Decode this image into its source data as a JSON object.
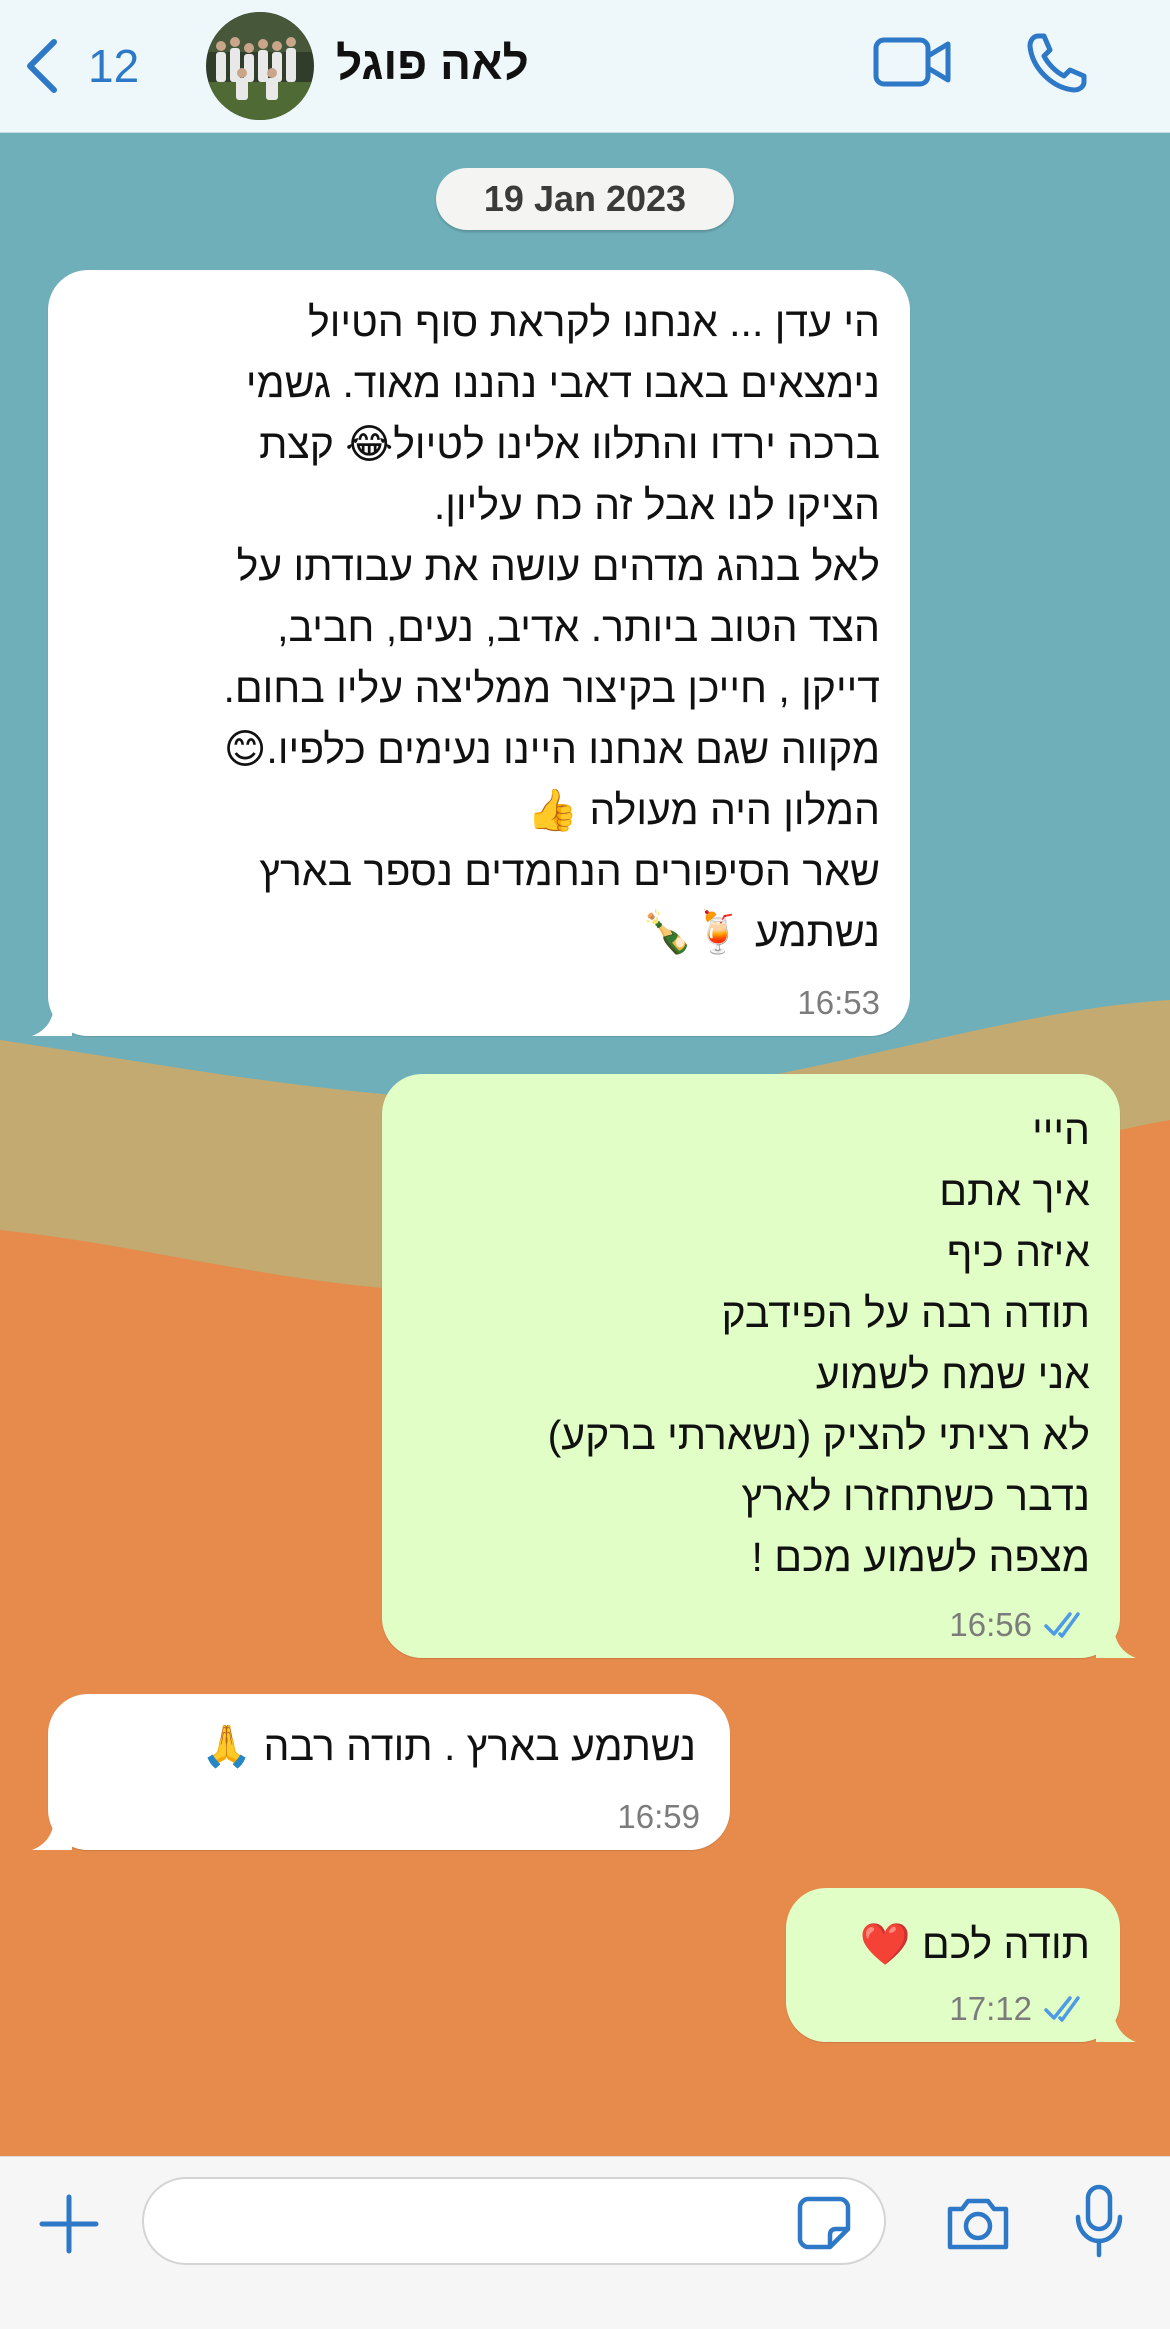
{
  "header": {
    "back_count": "12",
    "contact_name": "לאה פוגל",
    "icons": [
      "chevron-left-icon",
      "video-call-icon",
      "phone-icon"
    ]
  },
  "date_label": "19 Jan 2023",
  "messages": [
    {
      "direction": "incoming",
      "text": "הי עדן ... אנחנו לקראת סוף הטיול\nנימצאים באבו דאבי נהננו מאוד. גשמי\nברכה  ירדו והתלוו אלינו לטיול😂 קצת\nהציקו לנו אבל זה כח עליון.\nלאל בנהג מדהים עושה את עבודתו על\nהצד הטוב ביותר. אדיב, נעים, חביב,\nדייקן , חייכן בקיצור ממליצה עליו בחום.\nמקווה שגם אנחנו היינו נעימים כלפיו.😊\nהמלון היה מעולה 👍\nשאר הסיפורים  הנחמדים נספר בארץ\nנשתמע 🍹🍾",
      "time": "16:53"
    },
    {
      "direction": "outgoing",
      "text": "הייי\nאיך אתם\nאיזה כיף\nתודה רבה על הפידבק\nאני שמח לשמוע\nלא רציתי להציק (נשארתי ברקע)\nנדבר כשתחזרו לארץ\nמצפה לשמוע מכם !",
      "time": "16:56",
      "status": "read"
    },
    {
      "direction": "incoming",
      "text": "נשתמע בארץ . תודה רבה 🙏",
      "time": "16:59"
    },
    {
      "direction": "outgoing",
      "text": "תודה לכם ❤️",
      "time": "17:12",
      "status": "read"
    }
  ],
  "input": {
    "placeholder": ""
  },
  "colors": {
    "accent": "#2D79C7",
    "incoming_bubble": "#FFFFFF",
    "outgoing_bubble": "#E1FEC6",
    "header_bg": "#EEF7FA",
    "wallpaper_teal": "#6FAFBA",
    "wallpaper_olive": "#C2AA70",
    "wallpaper_orange": "#E68B4C"
  }
}
